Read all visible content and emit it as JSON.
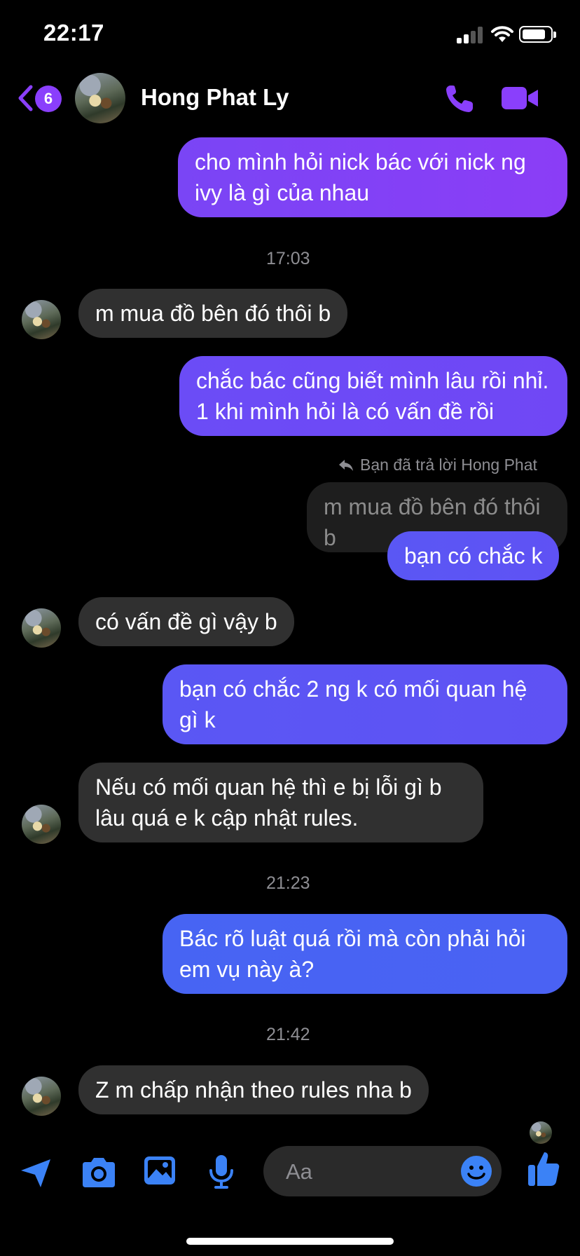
{
  "status_bar": {
    "time": "22:17"
  },
  "header": {
    "unread_count": "6",
    "contact_name": "Hong Phat Ly"
  },
  "messages": [
    {
      "sender": "me",
      "text": "cho mình hỏi nick bác với nick ng ivy là gì của nhau"
    },
    {
      "type": "timestamp",
      "text": "17:03"
    },
    {
      "sender": "them",
      "text": "m mua đồ bên đó thôi b"
    },
    {
      "sender": "me",
      "text": "chắc bác cũng biết mình lâu rồi nhỉ. 1 khi mình hỏi là có vấn đề rồi"
    },
    {
      "type": "reply_note",
      "text": "Bạn đã trả lời Hong Phat"
    },
    {
      "type": "quoted",
      "text": "m mua đồ bên đó thôi b"
    },
    {
      "sender": "me",
      "text": "bạn có chắc k"
    },
    {
      "sender": "them",
      "text": "có vấn đề gì vậy b"
    },
    {
      "sender": "me",
      "text": "bạn có chắc 2 ng k có mối quan hệ gì k"
    },
    {
      "sender": "them",
      "text": "Nếu có mối quan hệ thì e bị lỗi gì b lâu quá e k cập nhật rules."
    },
    {
      "type": "timestamp",
      "text": "21:23"
    },
    {
      "sender": "me",
      "text": "Bác rõ luật quá rồi mà còn phải hỏi em vụ này à?"
    },
    {
      "type": "timestamp",
      "text": "21:42"
    },
    {
      "sender": "them",
      "text": "Z m chấp nhận theo rules nha b"
    }
  ],
  "composer": {
    "placeholder": "Aa"
  },
  "colors": {
    "accent": "#8a3ffc",
    "composer_icons": "#3b82f6",
    "incoming_bubble": "#303030"
  },
  "icons": {
    "back": "chevron-left-icon",
    "call": "phone-icon",
    "video": "video-camera-icon",
    "location": "location-arrow-icon",
    "camera": "camera-icon",
    "gallery": "image-icon",
    "voice": "microphone-icon",
    "emoji": "smiley-icon",
    "like": "thumbs-up-icon"
  }
}
